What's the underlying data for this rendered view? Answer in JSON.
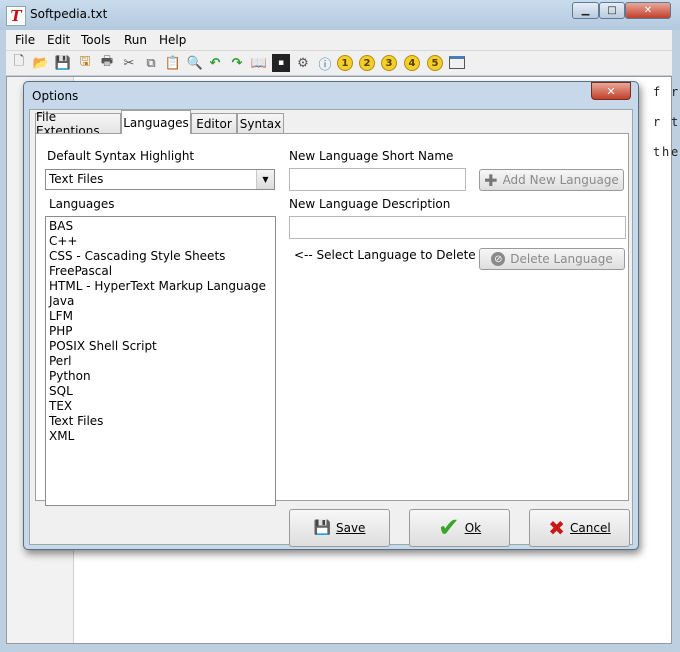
{
  "window": {
    "title": "Softpedia.txt",
    "controls": {
      "minimize": "▁",
      "maximize": "□",
      "close": "✕"
    }
  },
  "menu": [
    "File",
    "Edit",
    "Tools",
    "Run",
    "Help"
  ],
  "toolbar": {
    "icons": [
      "new-file-icon",
      "open-folder-icon",
      "save-icon",
      "save-all-icon",
      "print-icon",
      "cut-icon",
      "copy-icon",
      "paste-icon",
      "find-icon",
      "undo-icon",
      "redo-icon",
      "book-icon",
      "terminal-icon",
      "gear-icon",
      "info-icon",
      "bookmark-1-icon",
      "bookmark-2-icon",
      "bookmark-3-icon",
      "bookmark-4-icon",
      "bookmark-5-icon",
      "window-icon"
    ],
    "bookmarks": [
      "1",
      "2",
      "3",
      "4",
      "5"
    ]
  },
  "editor": {
    "right_chars": [
      "f",
      "r",
      "r",
      "t",
      "t",
      "h",
      "e"
    ]
  },
  "dialog": {
    "title": "Options",
    "close": "✕",
    "tabs": [
      "File Extentions",
      "Languages",
      "Editor",
      "Syntax"
    ],
    "active_tab": "Languages",
    "default_syntax_label": "Default Syntax Highlight",
    "default_syntax_value": "Text Files",
    "languages_label": "Languages",
    "languages": [
      "BAS",
      "C++",
      "CSS - Cascading Style Sheets",
      "FreePascal",
      "HTML - HyperText Markup Language",
      "Java",
      "LFM",
      "PHP",
      "POSIX Shell Script",
      "Perl",
      "Python",
      "SQL",
      "TEX",
      "Text Files",
      "XML"
    ],
    "short_name_label": "New Language Short Name",
    "short_name_value": "",
    "add_button": "Add New Language",
    "description_label": "New Language Description",
    "description_value": "",
    "delete_hint": "<-- Select Language to Delete -->",
    "delete_button": "Delete Language",
    "save_button": "Save",
    "ok_button": "Ok",
    "cancel_button": "Cancel"
  },
  "colors": {
    "accent_close": "#c1402a",
    "ok_check": "#3aa52b",
    "cancel_x": "#c81818",
    "bookmark": "#f2cf2a"
  }
}
